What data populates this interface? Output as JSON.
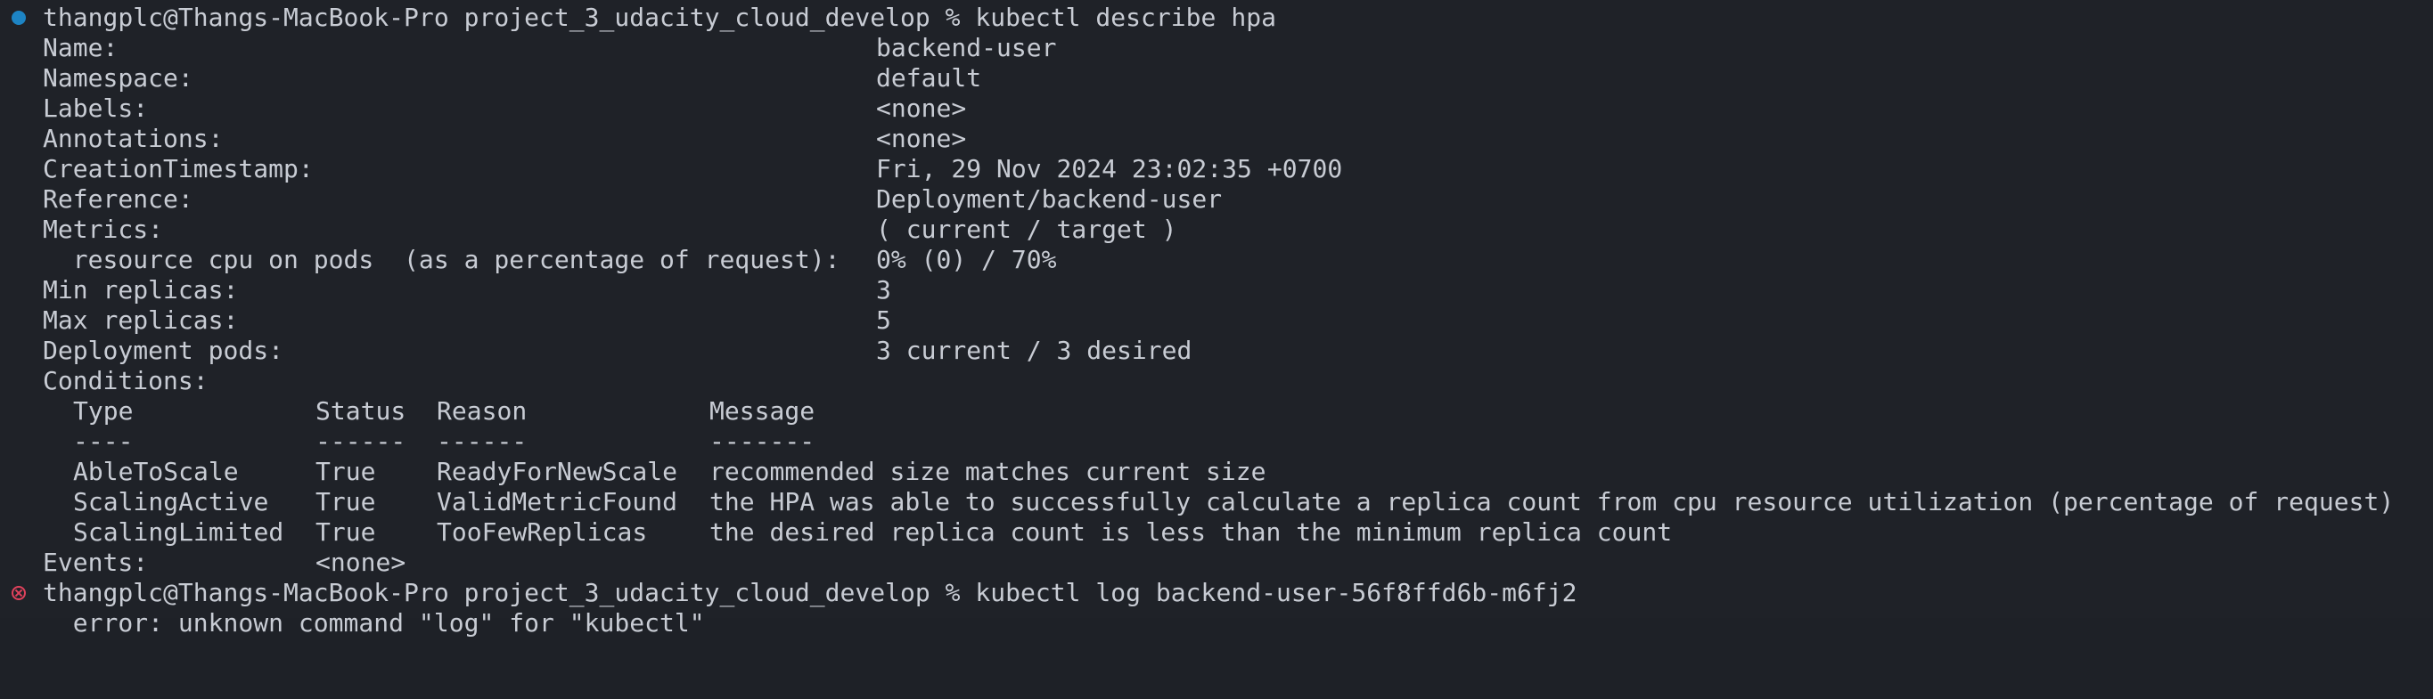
{
  "prompt1": "thangplc@Thangs-MacBook-Pro project_3_udacity_cloud_develop % kubectl describe hpa",
  "fields": [
    {
      "label": "Name:",
      "value": "backend-user"
    },
    {
      "label": "Namespace:",
      "value": "default"
    },
    {
      "label": "Labels:",
      "value": "<none>"
    },
    {
      "label": "Annotations:",
      "value": "<none>"
    },
    {
      "label": "CreationTimestamp:",
      "value": "Fri, 29 Nov 2024 23:02:35 +0700"
    },
    {
      "label": "Reference:",
      "value": "Deployment/backend-user"
    },
    {
      "label": "Metrics:",
      "value": "( current / target )"
    },
    {
      "label": "  resource cpu on pods  (as a percentage of request):",
      "value": "0% (0) / 70%"
    },
    {
      "label": "Min replicas:",
      "value": "3"
    },
    {
      "label": "Max replicas:",
      "value": "5"
    },
    {
      "label": "Deployment pods:",
      "value": "3 current / 3 desired"
    }
  ],
  "conditions_label": "Conditions:",
  "conditions": {
    "headers": [
      "Type",
      "Status",
      "Reason",
      "Message"
    ],
    "dividers": [
      "----",
      "------",
      "------",
      "-------"
    ],
    "rows": [
      [
        "AbleToScale",
        "True",
        "ReadyForNewScale",
        "recommended size matches current size"
      ],
      [
        "ScalingActive",
        "True",
        "ValidMetricFound",
        "the HPA was able to successfully calculate a replica count from cpu resource utilization (percentage of request)"
      ],
      [
        "ScalingLimited",
        "True",
        "TooFewReplicas",
        "the desired replica count is less than the minimum replica count"
      ]
    ]
  },
  "events": {
    "label": "Events:",
    "value": "<none>"
  },
  "prompt2": "thangplc@Thangs-MacBook-Pro project_3_udacity_cloud_develop % kubectl log backend-user-56f8ffd6b-m6fj2",
  "partial_line": "  error: unknown command \"log\" for \"kubectl\"",
  "marker_colors": {
    "success": "#1d84c4",
    "error": "#e0425c"
  }
}
